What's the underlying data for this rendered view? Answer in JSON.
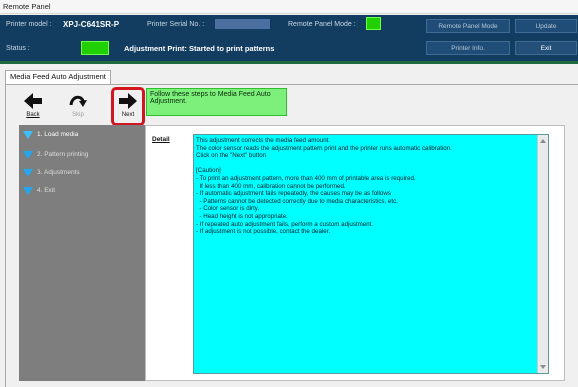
{
  "window": {
    "title": "Remote Panel"
  },
  "header": {
    "printer_model_label": "Printer model :",
    "printer_model_value": "XPJ-C641SR-P",
    "printer_serial_label": "Printer Serial No. :",
    "remote_panel_mode_label": "Remote Panel Mode :",
    "status_label": "Status :",
    "status_text": "Adjustment Print: Started to print patterns",
    "buttons": {
      "remote_panel_mode": "Remote Panel Mode",
      "update": "Update",
      "printer_info": "Printer Info.",
      "exit": "Exit"
    },
    "status_color": "#22d000"
  },
  "tab": {
    "label": "Media Feed Auto Adjustment"
  },
  "toolbar": {
    "back_label": "Back",
    "skip_label": "Skip",
    "next_label": "Next"
  },
  "instruction": "Follow these steps to Media Feed Auto Adjustment.",
  "steps": [
    {
      "label": "1. Load media"
    },
    {
      "label": "2. Pattern printing"
    },
    {
      "label": "3. Adjustments"
    },
    {
      "label": "4. Exit"
    }
  ],
  "detail": {
    "label": "Detail",
    "text": "This adjustment corrects the media feed amount.\nThe color sensor reads the adjustment pattern print and the printer runs automatic calibration.\nClick on the \"Next\" button\n\n[Caution]\n- To print an adjustment pattern, more than 400 mm of printable area is required.\n  If less than 400 mm, calibration cannot be performed.\n- If automatic adjustment fails repeatedly, the causes may be as follows\n  - Patterns cannot be detected correctly due to media characteristics, etc.\n  - Color sensor is dirty.\n  - Head height is not appropriate.\n- If repeated auto adjustment fails, perform a custom adjustment.\n- If adjustment is not possible, contact the dealer."
  },
  "colors": {
    "header_bg": "#123d60",
    "instruction_bg": "#7cf07a",
    "detail_bg": "#00ffff",
    "highlight": "#d2161f"
  }
}
